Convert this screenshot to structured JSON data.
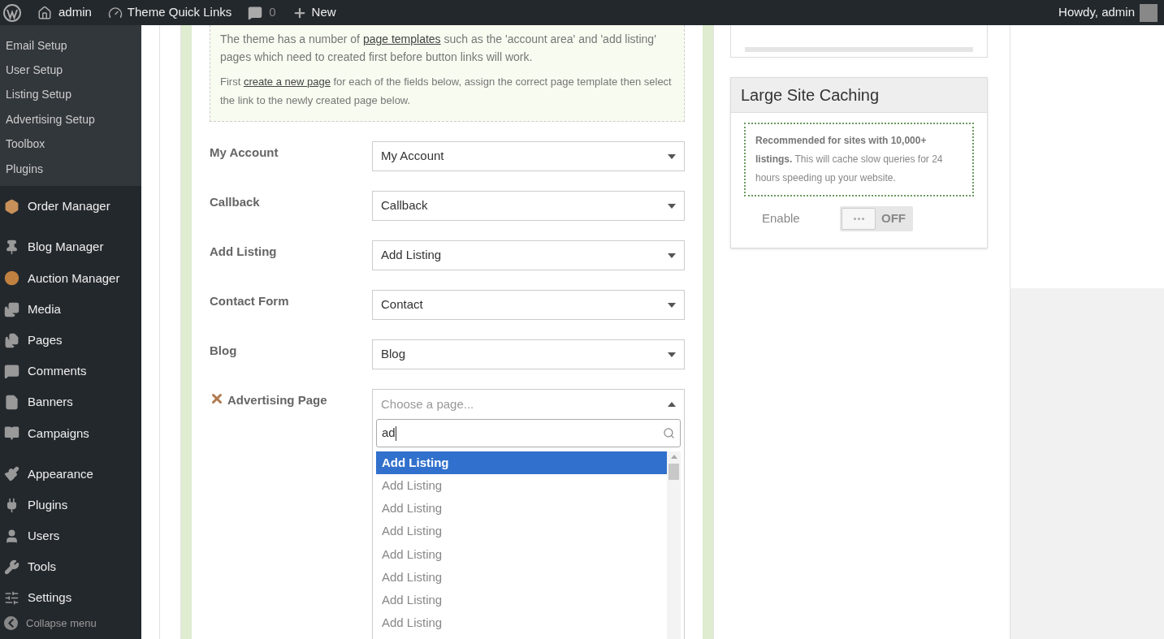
{
  "admin_bar": {
    "site": "admin",
    "quick_links": "Theme Quick Links",
    "comments": "0",
    "new": "New",
    "greeting": "Howdy, admin"
  },
  "sidebar": {
    "submenu": [
      {
        "label": "Email Setup",
        "selected": false
      },
      {
        "label": "User Setup",
        "selected": false
      },
      {
        "label": "Listing Setup",
        "selected": false
      },
      {
        "label": "Advertising Setup",
        "selected": false
      },
      {
        "label": "Toolbox",
        "selected": false
      },
      {
        "label": "Plugins",
        "selected": false
      }
    ],
    "menu_groups": [
      [
        {
          "label": "Order Manager"
        }
      ],
      [
        {
          "label": "Blog Manager"
        },
        {
          "label": "Auction Manager"
        },
        {
          "label": "Media"
        },
        {
          "label": "Pages"
        },
        {
          "label": "Comments"
        },
        {
          "label": "Banners"
        },
        {
          "label": "Campaigns"
        }
      ],
      [
        {
          "label": "Appearance"
        },
        {
          "label": "Plugins"
        },
        {
          "label": "Users"
        },
        {
          "label": "Tools"
        },
        {
          "label": "Settings"
        }
      ]
    ],
    "collapse": "Collapse menu"
  },
  "notice": {
    "paragraphs": [
      [
        {
          "text": "The theme has a number of "
        },
        {
          "text": "page templates",
          "link": true
        },
        {
          "text": " such as the 'account area' and 'add listing' pages which need to created first before button links will work."
        }
      ],
      [
        {
          "text": "First "
        },
        {
          "text": "create a new page",
          "link": true
        },
        {
          "text": " for each of the fields below, assign the correct page template then select the link to the newly created page below."
        }
      ]
    ]
  },
  "fields": [
    {
      "label": "My Account",
      "value": "My Account",
      "error": false,
      "open": false
    },
    {
      "label": "Callback",
      "value": "Callback",
      "error": false,
      "open": false
    },
    {
      "label": "Add Listing",
      "value": "Add Listing",
      "error": false,
      "open": false
    },
    {
      "label": "Contact Form",
      "value": "Contact",
      "error": false,
      "open": false
    },
    {
      "label": "Blog",
      "value": "Blog",
      "error": false,
      "open": false
    },
    {
      "label": "Advertising Page",
      "placeholder": "Choose a page...",
      "error": true,
      "open": true,
      "search": "ad",
      "options": [
        {
          "label": "Add Listing",
          "selected": true
        },
        {
          "label": "Add Listing",
          "selected": false
        },
        {
          "label": "Add Listing",
          "selected": false
        },
        {
          "label": "Add Listing",
          "selected": false
        },
        {
          "label": "Add Listing",
          "selected": false
        },
        {
          "label": "Add Listing",
          "selected": false
        },
        {
          "label": "Add Listing",
          "selected": false
        },
        {
          "label": "Add Listing",
          "selected": false
        }
      ]
    }
  ],
  "caching": {
    "title": "Large Site Caching",
    "note_bold": "Recommended for sites with 10,000+ listings.",
    "note": " This will cache slow queries for 24 hours speeding up your website.",
    "toggle_label": "Enable",
    "on": false,
    "state_text": "OFF"
  }
}
